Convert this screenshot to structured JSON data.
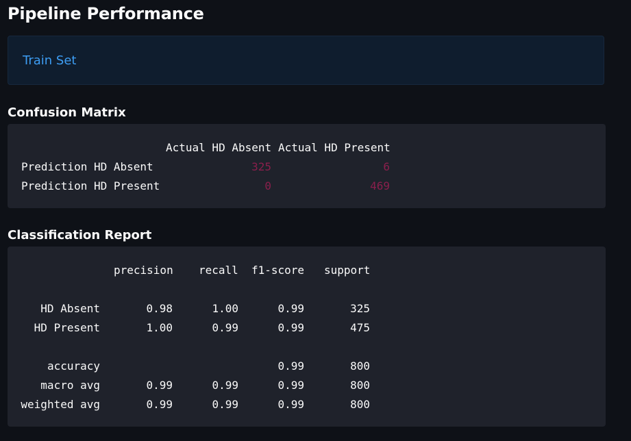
{
  "header": {
    "title": "Pipeline Performance"
  },
  "info": {
    "text": "Train Set"
  },
  "confusion_matrix": {
    "title": "Confusion Matrix",
    "columns": [
      "Actual HD Absent",
      "Actual HD Present"
    ],
    "rows": [
      {
        "label": "Prediction HD Absent",
        "values": [
          "325",
          "6"
        ]
      },
      {
        "label": "Prediction HD Present",
        "values": [
          "0",
          "469"
        ]
      }
    ]
  },
  "classification_report": {
    "title": "Classification Report",
    "columns": [
      "precision",
      "recall",
      "f1-score",
      "support"
    ],
    "rows": [
      {
        "label": "HD Absent",
        "precision": "0.98",
        "recall": "1.00",
        "f1": "0.99",
        "support": "325"
      },
      {
        "label": "HD Present",
        "precision": "1.00",
        "recall": "0.99",
        "f1": "0.99",
        "support": "475"
      }
    ],
    "summary": [
      {
        "label": "accuracy",
        "precision": "",
        "recall": "",
        "f1": "0.99",
        "support": "800"
      },
      {
        "label": "macro avg",
        "precision": "0.99",
        "recall": "0.99",
        "f1": "0.99",
        "support": "800"
      },
      {
        "label": "weighted avg",
        "precision": "0.99",
        "recall": "0.99",
        "f1": "0.99",
        "support": "800"
      }
    ]
  },
  "colors": {
    "background": "#0e1117",
    "info_bg": "#0f1d2e",
    "info_text": "#3d9df3",
    "code_bg": "#1f222b",
    "number_highlight": "#8a1f4c"
  }
}
